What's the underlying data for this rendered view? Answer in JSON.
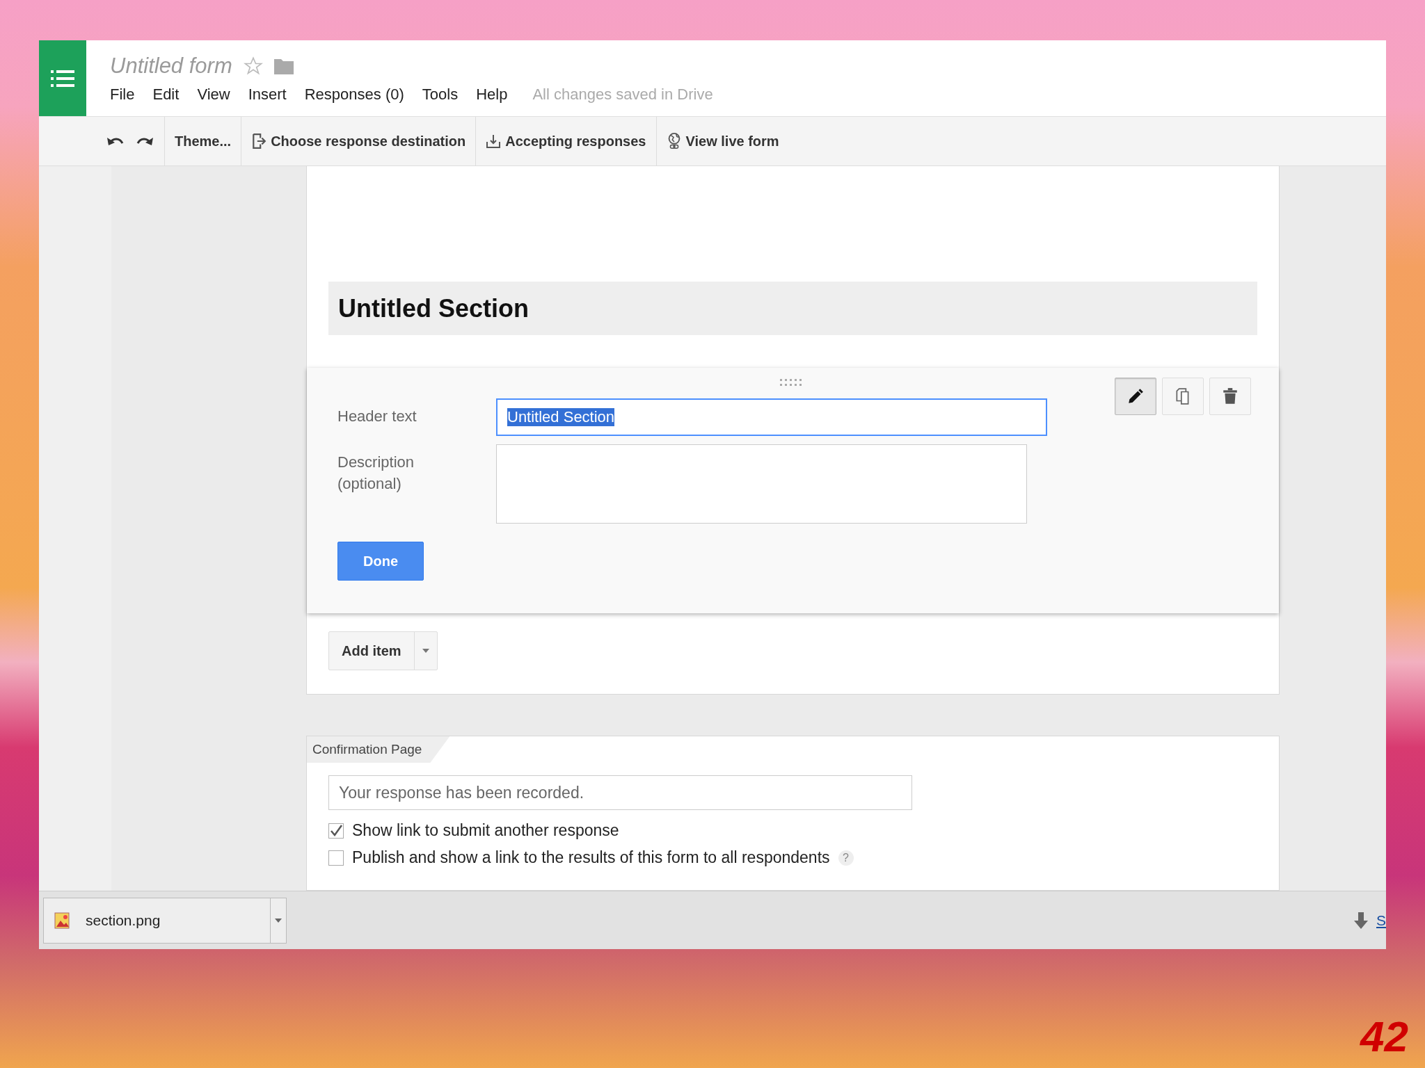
{
  "app": {
    "title": "Untitled form",
    "starred": false,
    "menu": [
      "File",
      "Edit",
      "View",
      "Insert",
      "Responses (0)",
      "Tools",
      "Help"
    ],
    "save_status": "All changes saved in Drive"
  },
  "toolbar": [
    {
      "kind": "theme",
      "label": "Theme..."
    },
    {
      "kind": "destination",
      "label": "Choose response destination"
    },
    {
      "kind": "accepting",
      "label": "Accepting responses"
    },
    {
      "kind": "live",
      "label": "View live form"
    }
  ],
  "section": {
    "title": "Untitled Section"
  },
  "editor": {
    "fields": [
      {
        "kind": "text",
        "label": "Header text",
        "value": "Untitled Section",
        "focused": true
      },
      {
        "kind": "textarea",
        "label": "Description (optional)",
        "focused": false
      }
    ],
    "done": "Done",
    "tools": [
      {
        "kind": "edit",
        "selected": true
      },
      {
        "kind": "copy",
        "selected": false
      },
      {
        "kind": "delete",
        "selected": false
      }
    ]
  },
  "add_item": {
    "label": "Add item"
  },
  "confirmation": {
    "tab": "Confirmation Page",
    "message": "Your response has been recorded.",
    "options": [
      {
        "label": "Show link to submit another response",
        "checked": true
      },
      {
        "label": "Publish and show a link to the results of this form to all respondents",
        "checked": false,
        "help": "?"
      }
    ]
  },
  "downloads": {
    "items": [
      {
        "name": "section.png"
      }
    ],
    "link": "S"
  },
  "slide": {
    "page_number": "42"
  }
}
